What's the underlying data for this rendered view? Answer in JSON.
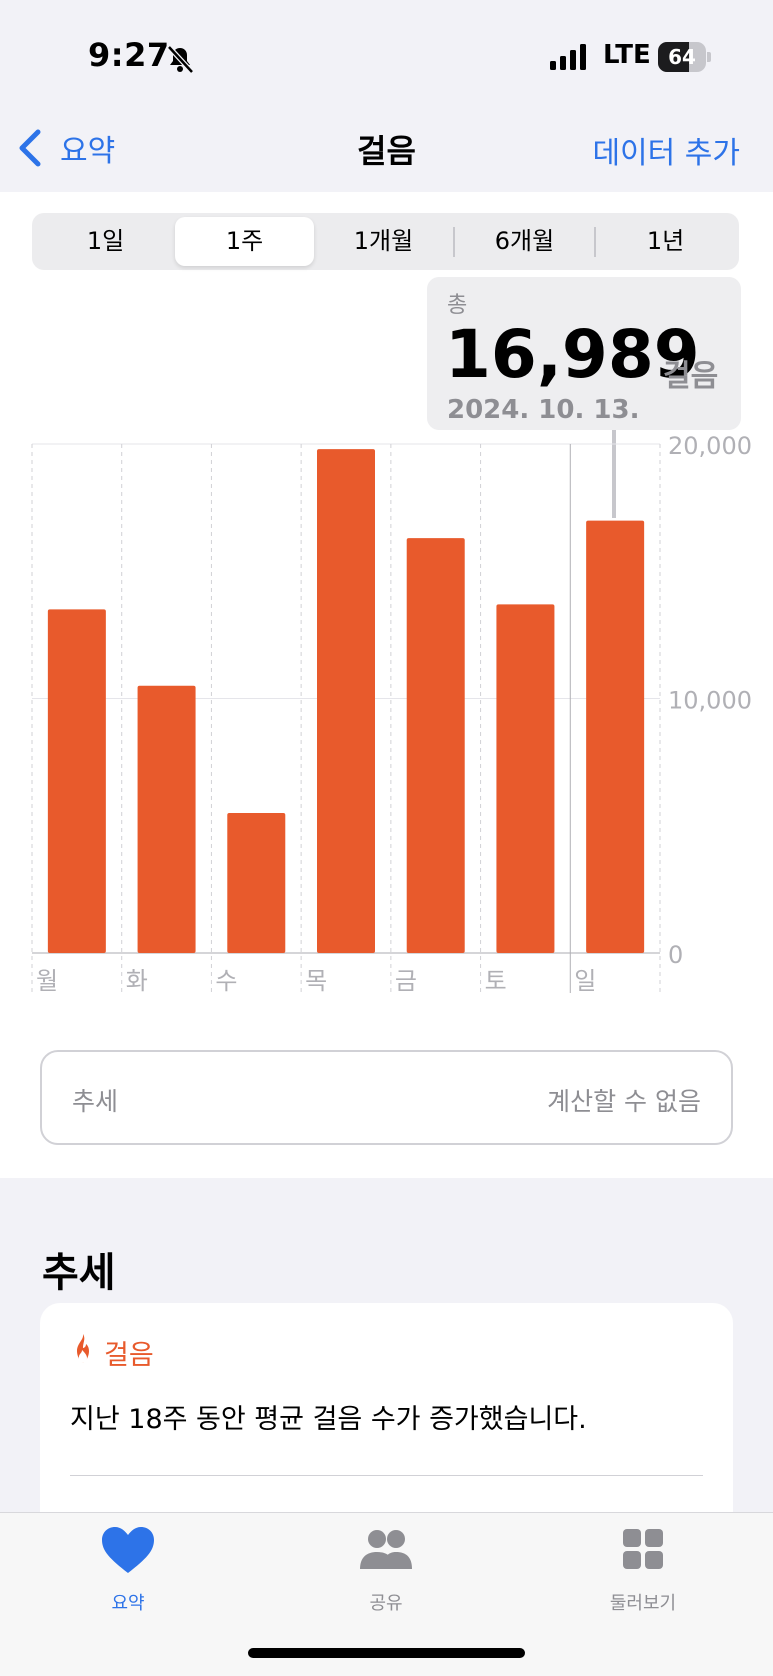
{
  "status_bar": {
    "time": "9:27",
    "network": "LTE",
    "battery_level": "64",
    "battery_fraction": 0.64,
    "icons": [
      "bell-slash-icon",
      "signal-icon"
    ]
  },
  "nav": {
    "back_label": "요약",
    "title": "걸음",
    "add_label": "데이터 추가"
  },
  "segments": [
    {
      "label": "1일",
      "active": false
    },
    {
      "label": "1주",
      "active": true
    },
    {
      "label": "1개월",
      "active": false
    },
    {
      "label": "6개월",
      "active": false
    },
    {
      "label": "1년",
      "active": false
    }
  ],
  "callout": {
    "label": "총",
    "value": "16,989",
    "unit": "걸음",
    "date": "2024. 10. 13."
  },
  "chart_data": {
    "type": "bar",
    "categories": [
      "월",
      "화",
      "수",
      "목",
      "금",
      "토",
      "일"
    ],
    "values": [
      13500,
      10500,
      5500,
      19800,
      16300,
      13700,
      16989
    ],
    "y_ticks": [
      "0",
      "10,000",
      "20,000"
    ],
    "ylim": [
      0,
      20000
    ],
    "grid": true,
    "bar_color": "#e85a2c",
    "selected_index": 6
  },
  "trend_card": {
    "label": "추세",
    "value": "계산할 수 없음"
  },
  "trends_section": {
    "title": "추세",
    "highlight": {
      "category": "걸음",
      "text": "지난 18주 동안 평균 걸음 수가 증가했습니다.",
      "icon": "flame-icon"
    }
  },
  "tabbar": {
    "items": [
      {
        "label": "요약",
        "icon": "heart-icon",
        "active": true
      },
      {
        "label": "공유",
        "icon": "people-icon",
        "active": false
      },
      {
        "label": "둘러보기",
        "icon": "grid-icon",
        "active": false
      }
    ]
  },
  "colors": {
    "accent": "#2d73e8",
    "bar": "#e85a2c",
    "secondary_text": "#8e8e93",
    "grouped_background": "#f2f2f7"
  }
}
